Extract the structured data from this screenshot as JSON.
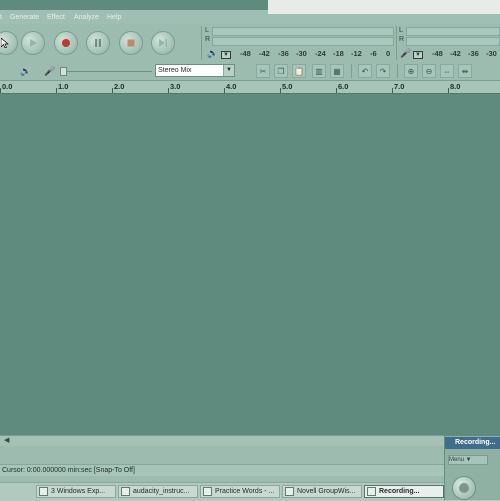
{
  "menu": {
    "items": [
      "t",
      "Generate",
      "Effect",
      "Analyze",
      "Help"
    ]
  },
  "meters": {
    "playback_ticks": [
      "-48",
      "-42",
      "-36",
      "-30",
      "-24",
      "-18",
      "-12",
      "-6",
      "0"
    ],
    "record_ticks": [
      "-48",
      "-42",
      "-36",
      "-30"
    ],
    "channel_left": "L",
    "channel_right": "R"
  },
  "input_source": {
    "selected": "Stereo Mix"
  },
  "ruler": {
    "labels": [
      "0.0",
      "1.0",
      "2.0",
      "3.0",
      "4.0",
      "5.0",
      "6.0",
      "7.0",
      "8.0"
    ]
  },
  "status": {
    "cursor_text": "Cursor: 0:00.000000 min:sec  [Snap-To Off]"
  },
  "taskbar": {
    "items": [
      "3 Windows Exp...",
      "audacity_instruc...",
      "Practice Words - ...",
      "Novell GroupWis...",
      "Recording..."
    ]
  },
  "recording_window": {
    "title": "Recording...",
    "menu_label": "Menu"
  },
  "colors": {
    "track_background": "#5e8b7e",
    "toolbar_background": "#9cbcaf",
    "record_button": "#c0392b"
  }
}
